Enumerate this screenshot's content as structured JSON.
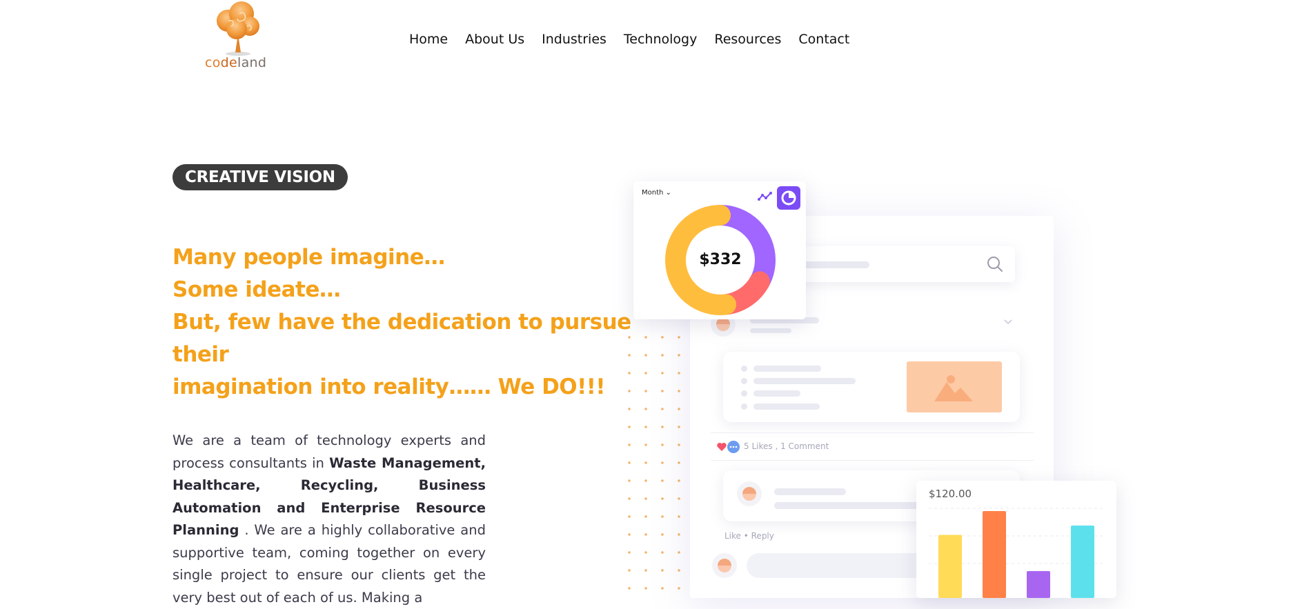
{
  "brand": {
    "logo_text_1": "co",
    "logo_text_2": "de",
    "logo_text_3": "land",
    "colors": {
      "orange": "#f4a11a",
      "dark": "#3c3c3c"
    }
  },
  "nav": {
    "items": [
      {
        "label": "Home"
      },
      {
        "label": "About Us"
      },
      {
        "label": "Industries"
      },
      {
        "label": "Technology"
      },
      {
        "label": "Resources"
      },
      {
        "label": "Contact"
      }
    ]
  },
  "hero": {
    "badge": "CREATIVE VISION",
    "headline_lines": [
      "Many people imagine…",
      "Some ideate…",
      "But, few have the dedication to pursue",
      "their",
      "imagination into reality…… We DO!!!"
    ],
    "body": {
      "p1": "We are a team of technology experts and process consultants in ",
      "p1_bold": "Waste Management, Healthcare, Recycling, Business Automation and Enterprise Resource Planning",
      "p2": " . We are a highly collaborative and supportive team, coming together on every single project to ensure our clients get the very best out of each of us. Making a"
    }
  },
  "illustration": {
    "donut": {
      "period_label": "Month",
      "value": "$332",
      "icons": [
        "trend-icon",
        "pie-chart-icon"
      ],
      "segments": [
        {
          "color": "#a066ff",
          "share": 0.33
        },
        {
          "color": "#ff6b6b",
          "share": 0.15
        },
        {
          "color": "#ffbd3e",
          "share": 0.52
        }
      ]
    },
    "social": {
      "likes_text": "5 Likes , 1 Comment",
      "like_reply": "Like  •  Reply",
      "icons": [
        "search-icon",
        "heart-icon",
        "chat-icon",
        "image-icon"
      ]
    },
    "bars": {
      "title": "$120.00",
      "colors": [
        "#ffdb58",
        "#ff8147",
        "#a866f0",
        "#5ce1ec"
      ],
      "values": [
        0.61,
        0.84,
        0.26,
        0.7
      ]
    }
  }
}
